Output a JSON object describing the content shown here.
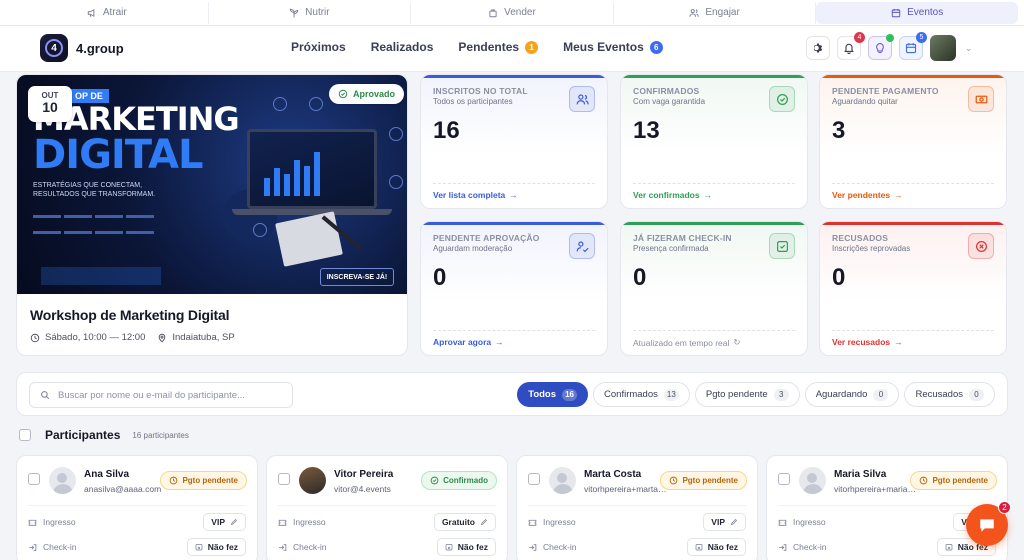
{
  "top_strip": {
    "items": [
      {
        "label": "Atrair",
        "icon": "megaphone-icon"
      },
      {
        "label": "Nutrir",
        "icon": "plant-icon"
      },
      {
        "label": "Vender",
        "icon": "bag-icon"
      },
      {
        "label": "Engajar",
        "icon": "users-icon"
      },
      {
        "label": "Eventos",
        "icon": "calendar-icon",
        "active": true
      }
    ]
  },
  "header": {
    "brand": "4.group",
    "logo_glyph": "4",
    "nav": [
      {
        "label": "Próximos"
      },
      {
        "label": "Realizados"
      },
      {
        "label": "Pendentes",
        "count": "1",
        "count_color": "#f4a41c"
      },
      {
        "label": "Meus Eventos",
        "count": "6",
        "count_color": "#3b6cf2"
      }
    ],
    "icons": [
      {
        "name": "settings",
        "badge": ""
      },
      {
        "name": "notifications",
        "badge": "4",
        "badge_color": "#e0364c"
      },
      {
        "name": "ai-assistant",
        "badge": "",
        "badge_color": "#2fbf5b"
      },
      {
        "name": "calendar",
        "badge": "5",
        "badge_color": "#3b6cf2"
      }
    ]
  },
  "event": {
    "date_month": "OUT",
    "date_day": "10",
    "status": "Aprovado",
    "name": "Workshop de Marketing Digital",
    "time": "Sábado, 10:00 — 12:00",
    "location": "Indaiatuba, SP",
    "poster": {
      "tag": "OP DE",
      "title_line1": "MARKETING",
      "title_line2": "DIGITAL",
      "subtitle": "ESTRATÉGIAS QUE CONECTAM, RESULTADOS QUE TRANSFORMAM.",
      "cta": "INSCREVA-SE JÁ!"
    }
  },
  "stats": [
    {
      "label": "INSCRITOS NO TOTAL",
      "sub": "Todos os participantes",
      "value": "16",
      "link": "Ver lista completa",
      "color": "#3b5bdb",
      "icon": "users-icon"
    },
    {
      "label": "CONFIRMADOS",
      "sub": "Com vaga garantida",
      "value": "13",
      "link": "Ver confirmados",
      "color": "#2f9e57",
      "icon": "check-circle-icon"
    },
    {
      "label": "PENDENTE PAGAMENTO",
      "sub": "Aguardando quitar",
      "value": "3",
      "link": "Ver pendentes",
      "color": "#e8590c",
      "icon": "money-icon"
    },
    {
      "label": "PENDENTE APROVAÇÃO",
      "sub": "Aguardam moderação",
      "value": "0",
      "link": "Aprovar agora",
      "color": "#3b5bdb",
      "icon": "user-check-icon"
    },
    {
      "label": "JÁ FIZERAM CHECK-IN",
      "sub": "Presença confirmada",
      "value": "0",
      "link": "Atualizado em tempo real",
      "color": "#2f9e57",
      "icon": "checkin-icon",
      "muted": true
    },
    {
      "label": "RECUSADOS",
      "sub": "Inscrições reprovadas",
      "value": "0",
      "link": "Ver recusados",
      "color": "#e03131",
      "icon": "x-circle-icon"
    }
  ],
  "filters": {
    "search_placeholder": "Buscar por nome ou e-mail do participante...",
    "chips": [
      {
        "label": "Todos",
        "count": "16",
        "active": true
      },
      {
        "label": "Confirmados",
        "count": "13"
      },
      {
        "label": "Pgto pendente",
        "count": "3"
      },
      {
        "label": "Aguardando",
        "count": "0"
      },
      {
        "label": "Recusados",
        "count": "0"
      }
    ]
  },
  "participants": {
    "title": "Participantes",
    "count_label": "16 participantes",
    "ingresso_label": "Ingresso",
    "checkin_label": "Check-in",
    "items": [
      {
        "name": "Ana Silva",
        "email": "anasilva@aaaa.com",
        "status": "Pgto pendente",
        "status_kind": "pending",
        "ticket": "VIP",
        "checkin": "Não fez",
        "photo": false
      },
      {
        "name": "Vitor Pereira",
        "email": "vitor@4.events",
        "status": "Confirmado",
        "status_kind": "confirmed",
        "ticket": "Gratuito",
        "checkin": "Não fez",
        "photo": true
      },
      {
        "name": "Marta Costa",
        "email": "vitorhpereira+martacosta@gmail.com",
        "status": "Pgto pendente",
        "status_kind": "pending",
        "ticket": "VIP",
        "checkin": "Não fez",
        "photo": false
      },
      {
        "name": "Maria Silva",
        "email": "vitorhpereira+mariasilva@gmail.com",
        "status": "Pgto pendente",
        "status_kind": "pending",
        "ticket": "VIP",
        "checkin": "Não fez",
        "photo": false
      }
    ]
  },
  "chat": {
    "badge": "2"
  }
}
